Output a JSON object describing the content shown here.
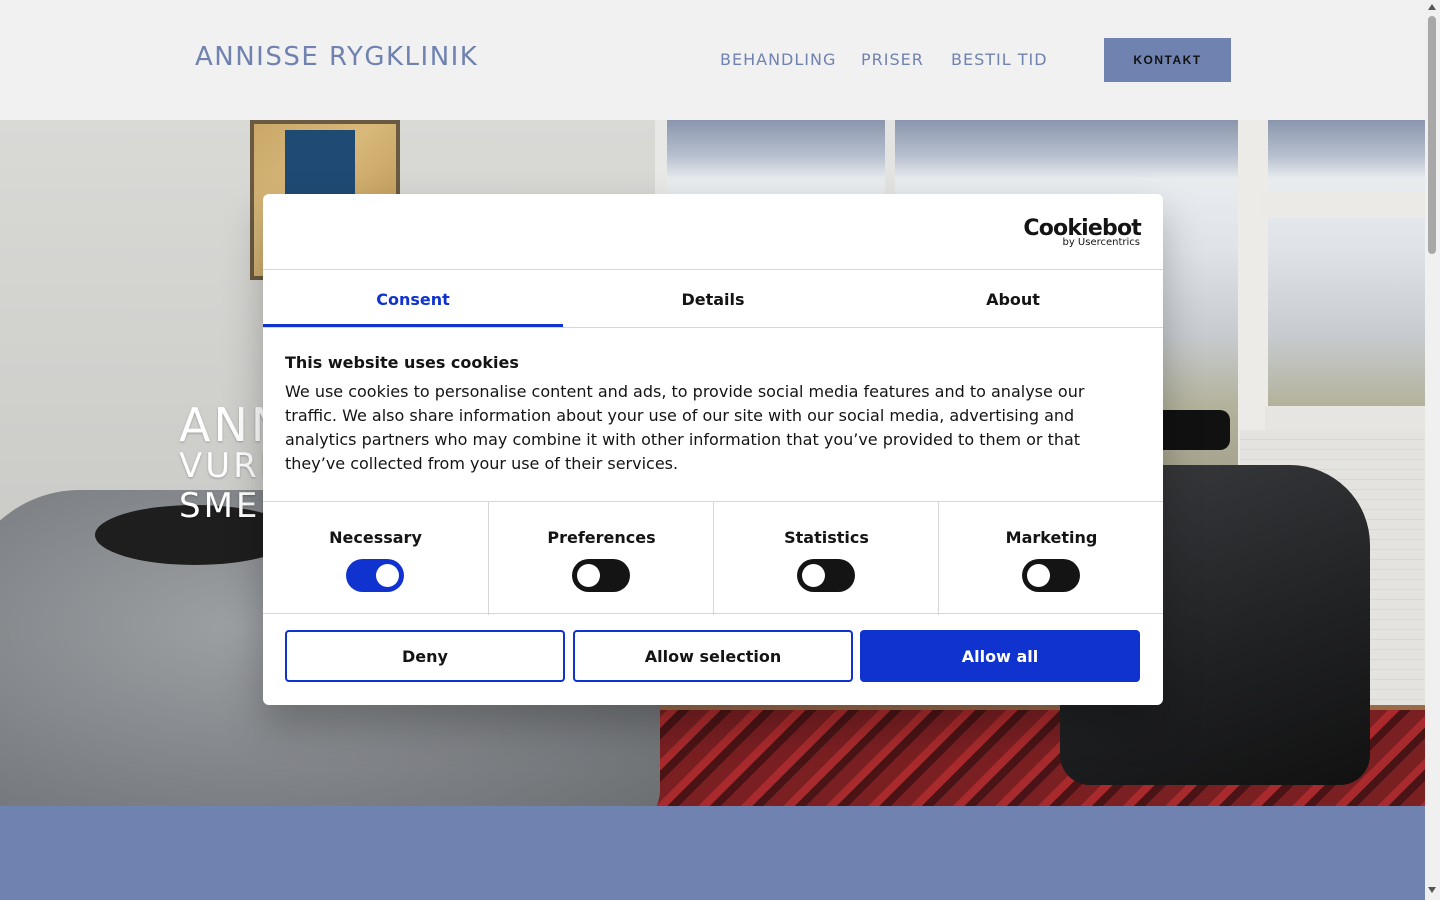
{
  "header": {
    "logo": "ANNISSE RYGKLINIK",
    "nav": [
      "BEHANDLING",
      "PRISER",
      "BESTIL TID"
    ],
    "contact_button": "KONTAKT"
  },
  "hero": {
    "title": "ANN",
    "subtitle_line1": "VURI",
    "subtitle_line2": "SMEI"
  },
  "cookie_dialog": {
    "brand": "Cookiebot",
    "brand_sub": "by Usercentrics",
    "tabs": [
      "Consent",
      "Details",
      "About"
    ],
    "active_tab": "Consent",
    "heading": "This website uses cookies",
    "body": "We use cookies to personalise content and ads, to provide social media features and to analyse our traffic. We also share information about your use of our site with our social media, advertising and analytics partners who may combine it with other information that you’ve provided to them or that they’ve collected from your use of their services.",
    "toggles": [
      {
        "label": "Necessary",
        "on": true
      },
      {
        "label": "Preferences",
        "on": false
      },
      {
        "label": "Statistics",
        "on": false
      },
      {
        "label": "Marketing",
        "on": false
      }
    ],
    "buttons": {
      "deny": "Deny",
      "allow_selection": "Allow selection",
      "allow_all": "Allow all"
    }
  },
  "colors": {
    "brand_blue": "#6f82b0",
    "cookiebot_blue": "#1032cf",
    "dark": "#141414"
  },
  "icons": {
    "scroll_up": "triangle-up",
    "scroll_down": "triangle-down"
  }
}
